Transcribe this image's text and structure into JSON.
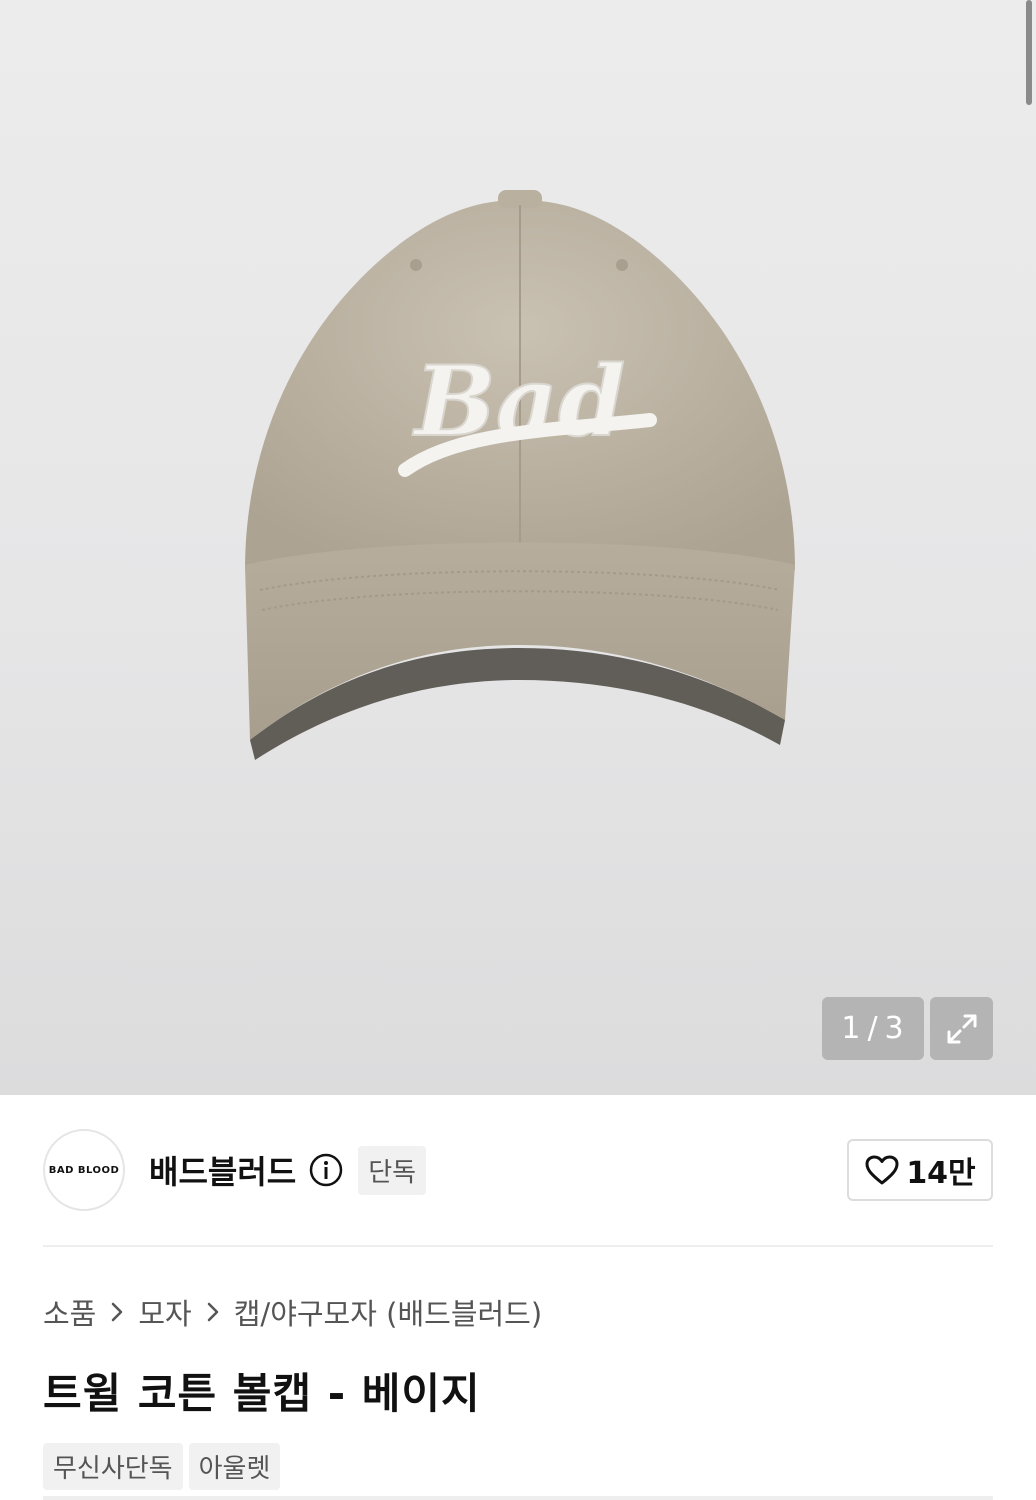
{
  "gallery": {
    "image_alt": "Bad cap",
    "logo_text": "Bad",
    "current": "1",
    "separator": "/",
    "total": "3",
    "expand_icon": "expand-icon"
  },
  "brand": {
    "logo_text": "BAD BLOOD",
    "name": "배드블러드",
    "info_icon": "info-icon",
    "exclusive_label": "단독",
    "like_icon": "heart-icon",
    "like_count": "14만"
  },
  "breadcrumb": {
    "items": [
      "소품",
      "모자",
      "캡/야구모자 (배드블러드)"
    ],
    "separator_icon": "chevron-right-icon"
  },
  "product": {
    "title": "트윌 코튼 볼캡 - 베이지",
    "tags": [
      "무신사단독",
      "아울렛"
    ]
  },
  "colors": {
    "cap": "#bfb6a6",
    "background": "#e9e9ea",
    "pager": "#b4b4b4"
  }
}
